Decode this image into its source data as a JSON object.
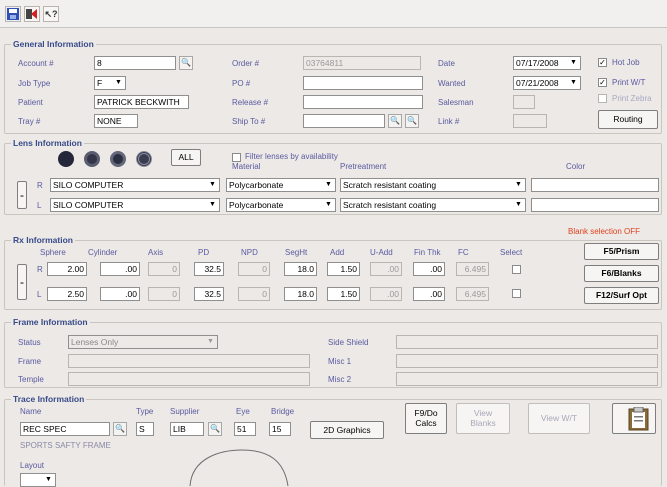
{
  "toolbar": {
    "icons": [
      "save-icon",
      "exit-icon",
      "help-icon"
    ]
  },
  "general": {
    "title": "General Information",
    "account_label": "Account #",
    "account_value": "8",
    "jobtype_label": "Job Type",
    "jobtype_value": "F",
    "patient_label": "Patient",
    "patient_value": "PATRICK BECKWITH",
    "tray_label": "Tray #",
    "tray_value": "NONE",
    "order_label": "Order #",
    "order_value": "03764811",
    "po_label": "PO #",
    "po_value": "",
    "release_label": "Release #",
    "release_value": "",
    "shipto_label": "Ship To #",
    "shipto_value": "",
    "date_label": "Date",
    "date_value": "07/17/2008",
    "wanted_label": "Wanted",
    "wanted_value": "07/21/2008",
    "salesman_label": "Salesman",
    "salesman_value": "",
    "link_label": "Link #",
    "link_value": "",
    "hotjob_label": "Hot Job",
    "printwt_label": "Print W/T",
    "printzebra_label": "Print Zebra",
    "routing_label": "Routing"
  },
  "lens": {
    "title": "Lens Information",
    "all_label": "ALL",
    "filter_label": "Filter lenses by availability",
    "material_header": "Material",
    "pretreatment_header": "Pretreatment",
    "color_header": "Color",
    "rows": [
      {
        "side": "R",
        "lens": "SILO COMPUTER",
        "material": "Polycarbonate",
        "pretreatment": "Scratch resistant coating",
        "color": ""
      },
      {
        "side": "L",
        "lens": "SILO COMPUTER",
        "material": "Polycarbonate",
        "pretreatment": "Scratch resistant coating",
        "color": ""
      }
    ]
  },
  "rx": {
    "title": "Rx Information",
    "blank_status": "Blank selection OFF",
    "headers": {
      "sphere": "Sphere",
      "cylinder": "Cylinder",
      "axis": "Axis",
      "pd": "PD",
      "npd": "NPD",
      "seght": "SegHt",
      "add": "Add",
      "uadd": "U-Add",
      "finthk": "Fin Thk",
      "fc": "FC",
      "select": "Select"
    },
    "rows": [
      {
        "side": "R",
        "sphere": "2.00",
        "cylinder": ".00",
        "axis": "0",
        "pd": "32.5",
        "npd": "0",
        "seght": "18.0",
        "add": "1.50",
        "uadd": ".00",
        "finthk": ".00",
        "fc": "6.495"
      },
      {
        "side": "L",
        "sphere": "2.50",
        "cylinder": ".00",
        "axis": "0",
        "pd": "32.5",
        "npd": "0",
        "seght": "18.0",
        "add": "1.50",
        "uadd": ".00",
        "finthk": ".00",
        "fc": "6.495"
      }
    ],
    "f5_label": "F5/Prism",
    "f6_label": "F6/Blanks",
    "f12_label": "F12/Surf Opt"
  },
  "frame": {
    "title": "Frame Information",
    "status_label": "Status",
    "status_value": "Lenses Only",
    "frame_label": "Frame",
    "temple_label": "Temple",
    "sideshield_label": "Side Shield",
    "misc1_label": "Misc 1",
    "misc2_label": "Misc 2"
  },
  "trace": {
    "title": "Trace Information",
    "name_label": "Name",
    "name_value": "REC SPEC",
    "type_label": "Type",
    "type_value": "S",
    "supplier_label": "Supplier",
    "supplier_value": "LIB",
    "eye_label": "Eye",
    "eye_value": "51",
    "bridge_label": "Bridge",
    "bridge_value": "15",
    "graphics_label": "2D Graphics",
    "frame_desc": "SPORTS SAFTY FRAME",
    "layout_label": "Layout",
    "f9_label_1": "F9/Do",
    "f9_label_2": "Calcs",
    "viewblanks_label_1": "View",
    "viewblanks_label_2": "Blanks",
    "viewwt_label": "View W/T"
  }
}
